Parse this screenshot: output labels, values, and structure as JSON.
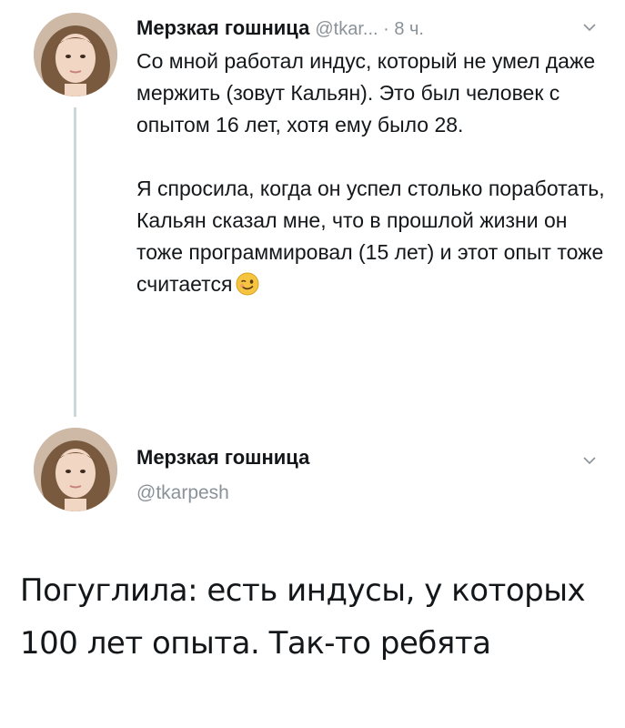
{
  "tweet": {
    "author_name": "Мерзкая гошница",
    "handle_time": "@tkar... · 8 ч.",
    "text_para1": "Со мной работал индус, который не умел даже мержить (зовут Кальян).  Это был человек с опытом 16 лет, хотя ему было 28.",
    "text_para2": "Я спросила, когда он успел столько поработать, Кальян сказал мне, что в прошлой жизни он тоже программировал (15 лет) и этот опыт тоже считается",
    "emoji": "winking-face-emoji"
  },
  "reply": {
    "author_name": "Мерзкая гошница",
    "handle": "@tkarpesh",
    "text": "Погуглила: есть индусы, у которых 100 лет опыта. Так-то ребята"
  },
  "colors": {
    "text": "#14171a",
    "meta": "#8a9299",
    "thread_line": "#ccd6dd"
  }
}
